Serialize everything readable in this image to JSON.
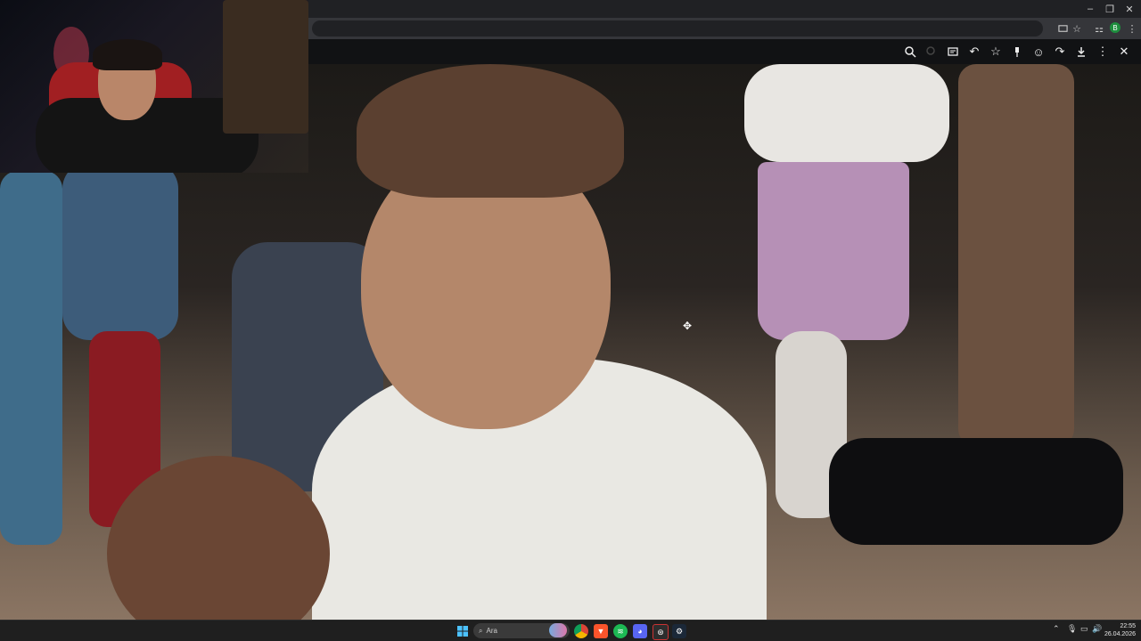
{
  "window": {
    "minimize_glyph": "–",
    "restore_glyph": "❐",
    "close_glyph": "✕"
  },
  "addressbar": {
    "icons": [
      "cast-icon",
      "star-icon",
      "extensions-icon",
      "profile-icon",
      "menu-icon"
    ],
    "profile_letter": "B"
  },
  "viewer_toolbar": {
    "icons": [
      "zoom-icon",
      "zoom-out-icon",
      "caption-icon",
      "back-icon",
      "bookmark-icon",
      "pin-icon",
      "emoji-icon",
      "share-icon",
      "download-icon",
      "more-icon",
      "close-icon"
    ]
  },
  "taskbar": {
    "search_placeholder": "Ara",
    "apps": [
      "windows-start-icon",
      "search-icon",
      "widgets-icon",
      "chrome-icon",
      "brave-icon",
      "spotify-icon",
      "discord-icon",
      "app-icon",
      "steam-icon"
    ]
  },
  "clock": {
    "time": "22:55",
    "date": "26.04.2026"
  },
  "colors": {
    "taskbar": "#1f1f1f",
    "toolbar": "#111214",
    "chrome": "#202124"
  }
}
